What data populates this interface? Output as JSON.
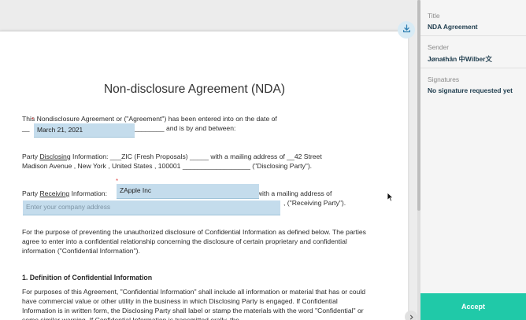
{
  "document": {
    "title": "Non-disclosure Agreement (NDA)",
    "intro_prefix": "This Nondisclosure Agreement or (\"Agreement\") has been entered into on the date of",
    "intro_blank_left": "__",
    "intro_blank_right": "________",
    "intro_suffix": "and is by and between:",
    "date_field_value": "March 21, 2021",
    "disclosing_prefix": "Party",
    "disclosing_word": "Disclosing",
    "disclosing_mid": "Information: ___ZIC (Fresh Proposals) _____ with a mailing address of __42 Street",
    "disclosing_line2": "Madison Avenue , New York , United States , 100001 __________________ (\"Disclosing Party\").",
    "receiving_prefix": "Party",
    "receiving_word": "Receiving",
    "receiving_mid": "Information:",
    "receiving_suffix": "with a mailing address of",
    "receiving_party_tail": ", (\"Receiving Party\").",
    "company_field_value": "ZApple Inc",
    "address_placeholder": "Enter your company address",
    "purpose_paragraph": "For the purpose of preventing the unauthorized disclosure of Confidential Information as defined below. The parties agree to enter into a confidential relationship concerning the disclosure of certain proprietary and confidential information (\"Confidential Information\").",
    "section1_heading": "1. Definition of Confidential Information",
    "section1_paragraph": "For purposes of this Agreement, \"Confidential Information\" shall include all information or material that has or could have commercial value or other utility in the business in which Disclosing Party is engaged. If Confidential Information is in written form, the Disclosing Party shall label or stamp the materials with the word \"Confidential\" or some similar warning. If Confidential Information is transmitted orally, the"
  },
  "sidebar": {
    "title_label": "Title",
    "title_value": "NDA Agreement",
    "sender_label": "Sender",
    "sender_value": "Jønaŧhân 中Wilber文",
    "signatures_label": "Signatures",
    "signatures_value": "No signature requested yet"
  },
  "actions": {
    "accept_label": "Accept"
  },
  "icons": {
    "download": "download-icon",
    "chevron": "chevron-right-icon",
    "cursor": "mouse-cursor-icon"
  },
  "colors": {
    "accent": "#20c9a8",
    "field_fill": "#c4dcec",
    "link_blue": "#2f7fb2"
  }
}
